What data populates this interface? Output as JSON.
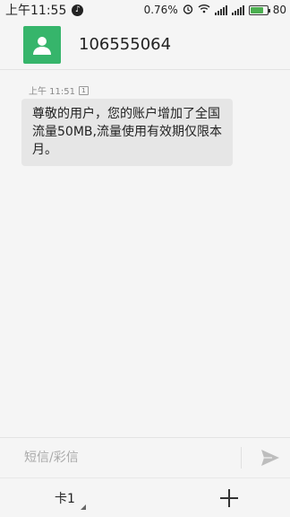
{
  "status_bar": {
    "time": "上午11:55",
    "left_icon": "notification-badge-icon",
    "data_speed": "0.76%",
    "icons": [
      "alarm-icon",
      "wifi-icon",
      "signal-icon",
      "signal-icon",
      "battery-icon"
    ],
    "battery_level": "80",
    "battery_fraction": 0.8
  },
  "contact": {
    "avatar_icon": "person-icon",
    "avatar_color": "#36b56b",
    "number": "106555064"
  },
  "messages": [
    {
      "time": "上午 11:51",
      "sim": "1",
      "text": "尊敬的用户，您的账户增加了全国流量50MB,流量使用有效期仅限本月。"
    }
  ],
  "composer": {
    "placeholder": "短信/彩信",
    "send_icon": "send-icon"
  },
  "bottom_bar": {
    "sim_label": "卡1",
    "add_icon": "plus-icon"
  }
}
